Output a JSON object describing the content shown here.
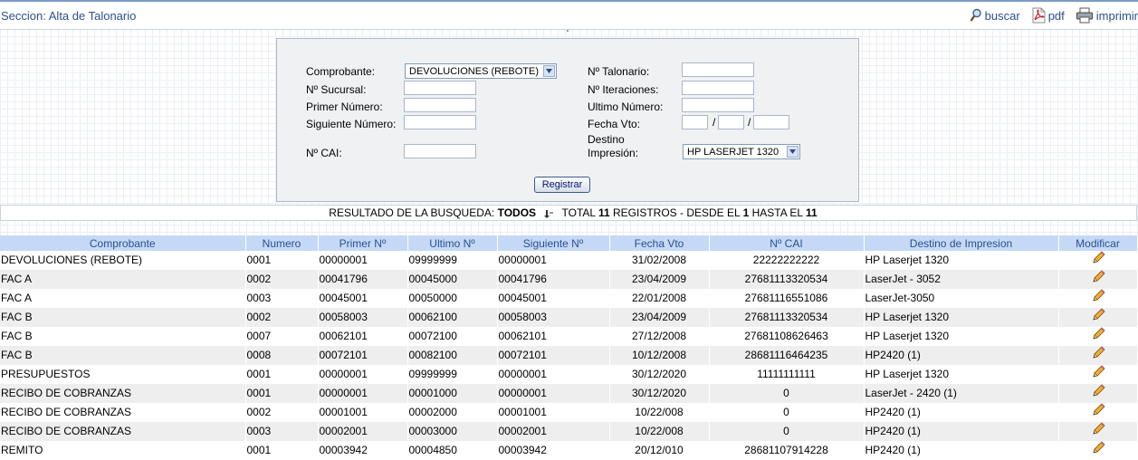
{
  "header": {
    "section_title": "Seccion: Alta de Talonario",
    "buscar": "buscar",
    "pdf": "pdf",
    "imprimir": "imprimir"
  },
  "form": {
    "comprobante_label": "Comprobante:",
    "comprobante_value": "DEVOLUCIONES (REBOTE)",
    "sucursal_label": "Nº Sucursal:",
    "primer_numero_label": "Primer Número:",
    "siguiente_numero_label": "Siguiente Número:",
    "cai_label": "Nº CAI:",
    "talonario_label": "Nº Talonario:",
    "iteraciones_label": "Nº Iteraciones:",
    "ultimo_numero_label": "Ultimo Número:",
    "fecha_vto_label": "Fecha Vto:",
    "destino_label_1": "Destino",
    "destino_label_2": "Impresión:",
    "destino_value": "HP LASERJET 1320",
    "date_separator": "/",
    "submit_label": "Registrar"
  },
  "results": {
    "prefix": "RESULTADO DE LA BUSQUEDA:",
    "filter": "TODOS",
    "total_label": "TOTAL",
    "total": "11",
    "registros_label": "REGISTROS - DESDE EL",
    "desde": "1",
    "hasta_label": "HASTA EL",
    "hasta": "11"
  },
  "table": {
    "headers": [
      "Comprobante",
      "Numero",
      "Primer Nº",
      "Ultimo Nº",
      "Siguiente Nº",
      "Fecha Vto",
      "Nº CAI",
      "Destino de Impresion",
      "Modificar"
    ],
    "rows": [
      [
        "DEVOLUCIONES (REBOTE)",
        "0001",
        "00000001",
        "09999999",
        "00000001",
        "31/02/2008",
        "22222222222",
        "HP Laserjet 1320"
      ],
      [
        "FAC A",
        "0002",
        "00041796",
        "00045000",
        "00041796",
        "23/04/2009",
        "27681113320534",
        "LaserJet - 3052"
      ],
      [
        "FAC A",
        "0003",
        "00045001",
        "00050000",
        "00045001",
        "22/01/2008",
        "27681116551086",
        "LaserJet-3050"
      ],
      [
        "FAC B",
        "0002",
        "00058003",
        "00062100",
        "00058003",
        "23/04/2009",
        "27681113320534",
        "HP Laserjet 1320"
      ],
      [
        "FAC B",
        "0007",
        "00062101",
        "00072100",
        "00062101",
        "27/12/2008",
        "27681108626463",
        "HP Laserjet 1320"
      ],
      [
        "FAC B",
        "0008",
        "00072101",
        "00082100",
        "00072101",
        "10/12/2008",
        "28681116464235",
        "HP2420 (1)"
      ],
      [
        "PRESUPUESTOS",
        "0001",
        "00000001",
        "09999999",
        "00000001",
        "30/12/2020",
        "11111111111",
        "HP Laserjet 1320"
      ],
      [
        "RECIBO DE COBRANZAS",
        "0001",
        "00000001",
        "00001000",
        "00000001",
        "30/12/2020",
        "0",
        "LaserJet - 2420 (1)"
      ],
      [
        "RECIBO DE COBRANZAS",
        "0002",
        "00001001",
        "00002000",
        "00001001",
        "10/22/008",
        "0",
        "HP2420 (1)"
      ],
      [
        "RECIBO DE COBRANZAS",
        "0003",
        "00002001",
        "00003000",
        "00002001",
        "10/22/008",
        "0",
        "HP2420 (1)"
      ],
      [
        "REMITO",
        "0001",
        "00003942",
        "00004850",
        "00003942",
        "20/12/010",
        "28681107914228",
        "HP2420 (1)"
      ]
    ]
  },
  "icons": {
    "search": "magnifier-icon",
    "pdf": "pdf-icon",
    "print": "printer-icon",
    "sort": "sort-arrow-icon",
    "edit": "pencil-icon"
  },
  "colors": {
    "title_blue": "#2a4f8f",
    "header_bg": "#c5d9f6",
    "row_alt": "#eeeeee",
    "panel_bg": "#f0f1f3"
  }
}
